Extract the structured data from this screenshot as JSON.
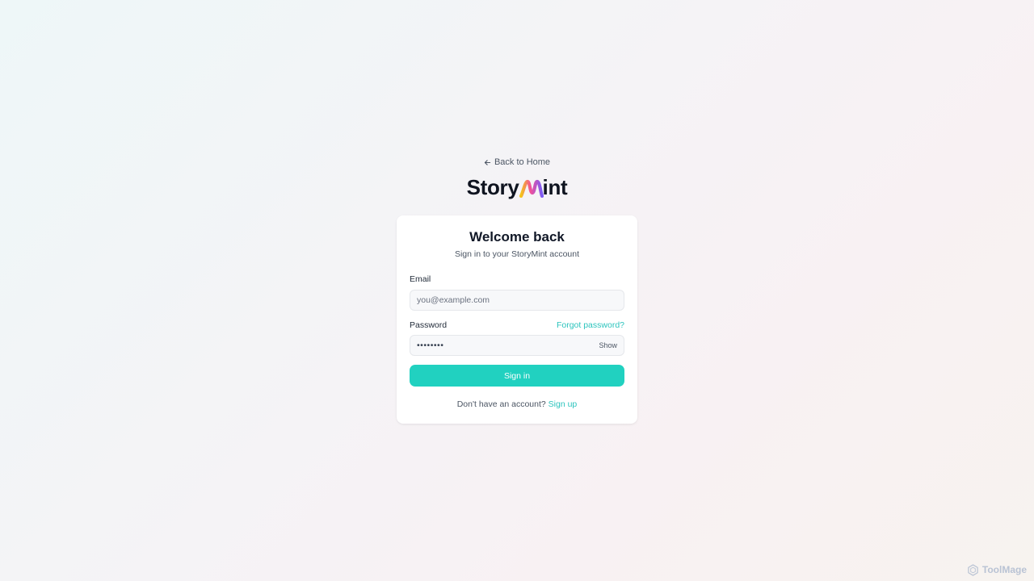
{
  "nav": {
    "back_label": "Back to Home"
  },
  "brand": {
    "name_prefix": "Story",
    "name_suffix": "int",
    "name": "StoryMint"
  },
  "card": {
    "title": "Welcome back",
    "subtitle": "Sign in to your StoryMint account"
  },
  "form": {
    "email_label": "Email",
    "email_placeholder": "you@example.com",
    "email_value": "",
    "password_label": "Password",
    "forgot_label": "Forgot password?",
    "password_value": "••••••••",
    "show_label": "Show",
    "submit_label": "Sign in"
  },
  "footer": {
    "prompt": "Don't have an account?",
    "signup_label": "Sign up"
  },
  "watermark": {
    "text": "ToolMage"
  },
  "colors": {
    "accent": "#21d1c0",
    "link": "#2cc4bd",
    "logo_gradient": [
      "#f5c518",
      "#f2509a",
      "#7c5cf5"
    ]
  },
  "icons": {
    "back": "arrow-left-icon",
    "logo_mark": "m-wave-logo-icon",
    "watermark": "hexagon-logo-icon"
  }
}
